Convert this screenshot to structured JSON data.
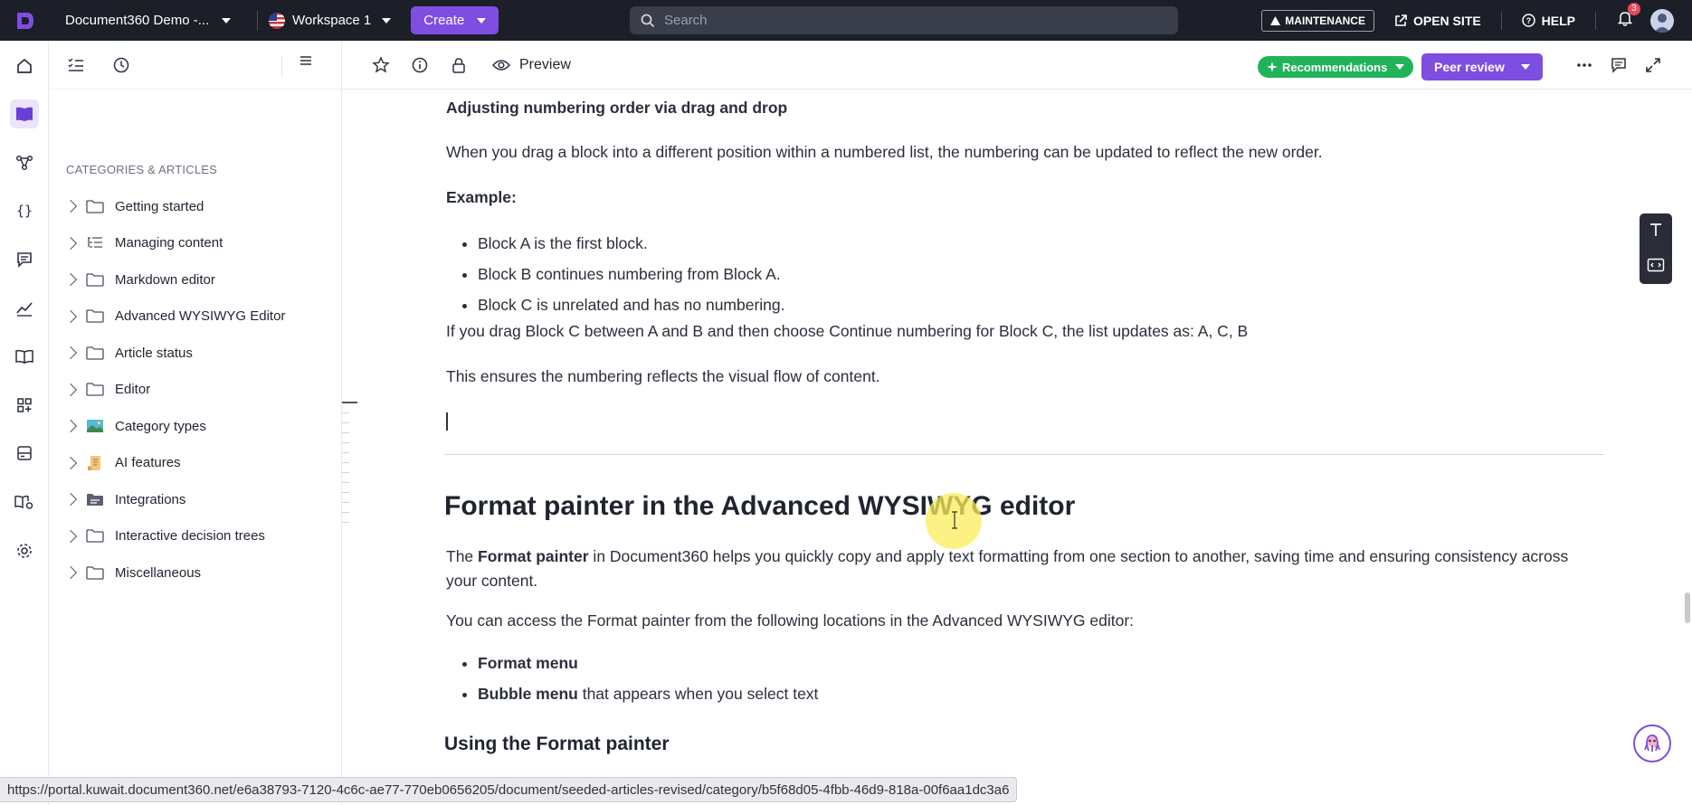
{
  "topbar": {
    "project_name": "Document360 Demo -...",
    "workspace_name": "Workspace 1",
    "create_label": "Create",
    "search_placeholder": "Search",
    "maintenance_label": "MAINTENANCE",
    "open_site_label": "OPEN SITE",
    "help_label": "HELP",
    "notification_count": "3"
  },
  "sidebar": {
    "title": "CATEGORIES & ARTICLES",
    "items": [
      {
        "label": "Getting started",
        "icon": "folder-icon"
      },
      {
        "label": "Managing content",
        "icon": "list-tree-icon"
      },
      {
        "label": "Markdown editor",
        "icon": "folder-icon"
      },
      {
        "label": "Advanced WYSIWYG Editor",
        "icon": "folder-icon"
      },
      {
        "label": "Article status",
        "icon": "folder-icon"
      },
      {
        "label": "Editor",
        "icon": "folder-icon"
      },
      {
        "label": "Category types",
        "icon": "image-icon"
      },
      {
        "label": "AI features",
        "icon": "scroll-icon"
      },
      {
        "label": "Integrations",
        "icon": "folder-filled-icon"
      },
      {
        "label": "Interactive decision trees",
        "icon": "folder-icon"
      },
      {
        "label": "Miscellaneous",
        "icon": "folder-icon"
      }
    ]
  },
  "editor_toolbar": {
    "preview_label": "Preview",
    "recommendations_label": "Recommendations",
    "peer_review_label": "Peer review"
  },
  "document": {
    "section_heading": "Adjusting numbering order via drag and drop",
    "para1": "When you drag a block into a different position within a numbered list, the numbering can be updated to reflect the new order.",
    "example_label": "Example:",
    "bullets": [
      "Block A is the first block.",
      "Block B continues numbering from Block A.",
      "Block C is unrelated and has no numbering."
    ],
    "para2": "If you drag Block C between A and B and then choose Continue numbering for Block C, the list updates as: A, C, B",
    "para3": "This ensures the numbering reflects the visual flow of content.",
    "h2": "Format painter in the Advanced WYSIWYG editor",
    "fp_para_pre": "The ",
    "fp_para_bold": "Format painter",
    "fp_para_post": " in Document360 helps you quickly copy and apply text formatting from one section to another, saving time and ensuring consistency across your content.",
    "access_para": "You can access the Format painter from the following locations in the Advanced WYSIWYG editor:",
    "access_bullets": [
      {
        "bold": "Format menu",
        "rest": ""
      },
      {
        "bold": "Bubble menu",
        "rest": " that appears when you select text"
      }
    ],
    "h3": "Using the Format painter"
  },
  "statusbar": {
    "url": "https://portal.kuwait.document360.net/e6a38793-7120-4c6c-ae77-770eb0656205/document/seeded-articles-revised/category/b5f68d05-4fbb-46d9-818a-00f6aa1dc3a6"
  },
  "colors": {
    "topbar_bg": "#1c1e28",
    "accent_purple": "#7e4ee0",
    "recommendations_green": "#21b35a"
  }
}
